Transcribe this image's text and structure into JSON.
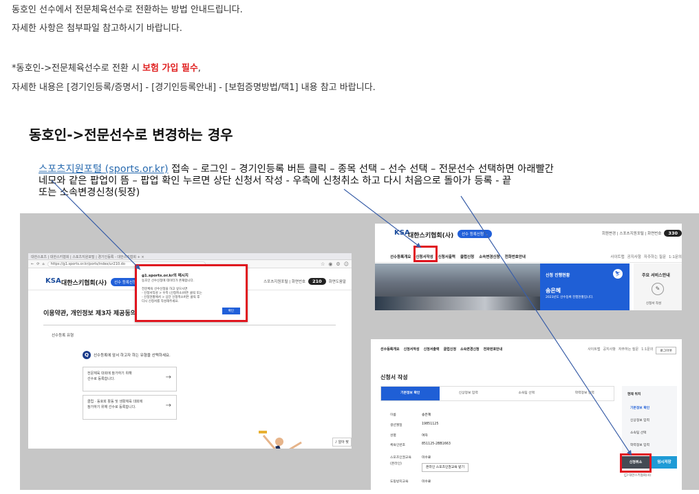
{
  "intro": {
    "line1": "동호인 선수에서 전문체육선수로 전환하는 방법 안내드립니다.",
    "line2": "자세한 사항은 첨부파일 참고하시기 바랍니다.",
    "line3_prefix": "*동호인->전문체육선수로 전환 시 ",
    "line3_strong": "보험 가입 필수",
    "line3_suffix": ",",
    "line4": "자세한 내용은 [경기인등록/증명서] - [경기인등록안내] - [보험증명방법/택1] 내용 참고 바랍니다."
  },
  "section_title": "동호인->전문선수로 변경하는 경우",
  "steps": {
    "link": "스포츠지원포털 (sports.or.kr)",
    "text1": " 접속 – 로그인 – 경기인등록 버튼 클릭 – 종목 선택 – 선수 선택 – 전문선수 선택하면 아래빨간",
    "text2": "네모와 같은 팝업이 뜸 – 팝업 확인 누르면  상단 신청서 작성 - 우측에 신청취소 하고 다시 처음으로 돌아가 등록 - 끝",
    "text3": "또는 소속변경신청(뒷장)"
  },
  "shot1": {
    "tabs": "대한스포츠 | 대한스키협회 | 스포츠지원포털 | 경기인등록 - 대한스키협회 + ×",
    "url": "https://g1.sports.or.kr/ports/index/ur210.do",
    "site_name": "대한스키협회(사)",
    "logo": "KSA",
    "pill": "선수 등록신청 ⌄",
    "links": "스포츠지원포털 | 화면번호",
    "screen_no": "210",
    "screen_btn": "화면도움말",
    "page_heading": "이용약관, 개인정보 제3자 제공동의",
    "card_label": "선수등록 유형",
    "q_num": "Q",
    "q_text": "선수등록에 앞서 하고자 하는 유형을 선택하세요.",
    "opt1": "전문체육 대회에 참가하기 위해\n선수로 등록합니다.",
    "opt2": "클럽 · 동호회 활동 및 생활체육 대회에\n참가하기 위해 선수로 등록합니다.",
    "chat": "♪ 알아 맞",
    "popup_title": "g1.sports.or.kr의 메시지",
    "popup_body": "동호인 선수신청에 데이터가 존재합니다.\n\n전문체육 선수신청을 하고 싶으시면\n- 신청서작성 > 우측 (신청취소)버튼 클릭 또는\n- 신청현황에서 > 상단 신청취소버튼 클릭 후\n다시 신청서를 작성해주세요.",
    "popup_ok": "확인"
  },
  "shot2": {
    "logo": "KSA",
    "site_name": "대한스키협회(사)",
    "pill": "선수 등록신청 ⌄",
    "links": "회원변경 | 스포츠지원포털 | 화면번호",
    "screen_no": "330",
    "nav": [
      "선수등록개요",
      "신청서작성",
      "신청서출력",
      "클럽신청",
      "소속변경신청",
      "전화번호안내"
    ],
    "nav_right": [
      "사이트맵",
      "공지사항",
      "자주하는 질문",
      "1:1문의"
    ],
    "panel_title": "신청 진행현황",
    "panel_name": "송은혜",
    "panel_sub": "2023년도 선수등록 진행현황입니다.",
    "svc_title": "주요 서비스안내",
    "svc_item": "신청서 작성"
  },
  "shot3": {
    "nav": [
      "선수등록개요",
      "신청서작성",
      "신청서출력",
      "클럽신청",
      "소속변경신청",
      "전화번호안내"
    ],
    "nav_right": [
      "사이트맵",
      "공지사항",
      "자주하는 질문",
      "1:1문의",
      "로그아웃"
    ],
    "heading": "신청서 작성",
    "steps": [
      "기본정보 확인",
      "신상정보 입력",
      "소속팀 선택",
      "학력정보 입력"
    ],
    "rows": [
      {
        "label": "이름",
        "value": "송은혜"
      },
      {
        "label": "생년월일",
        "value": "19851125"
      },
      {
        "label": "성별",
        "value": "여자"
      },
      {
        "label": "체육인번호",
        "value": "851125-2BB1663"
      }
    ],
    "edu_label": "스포츠인권교육\n(온라인)",
    "edu_value": "미수료",
    "edu_btn": "온라인 스포츠인권교육 받기",
    "doping_label": "도핑방지교육",
    "doping_value": "미수료",
    "side_title": "현재 위치",
    "side_items": [
      "기본정보 확인",
      "신상정보 입력",
      "소속팀 선택",
      "학력정보 입력"
    ],
    "btn_cancel": "신청취소",
    "btn_save": "임시저장",
    "side_foot": "대한스키협회(사)"
  }
}
